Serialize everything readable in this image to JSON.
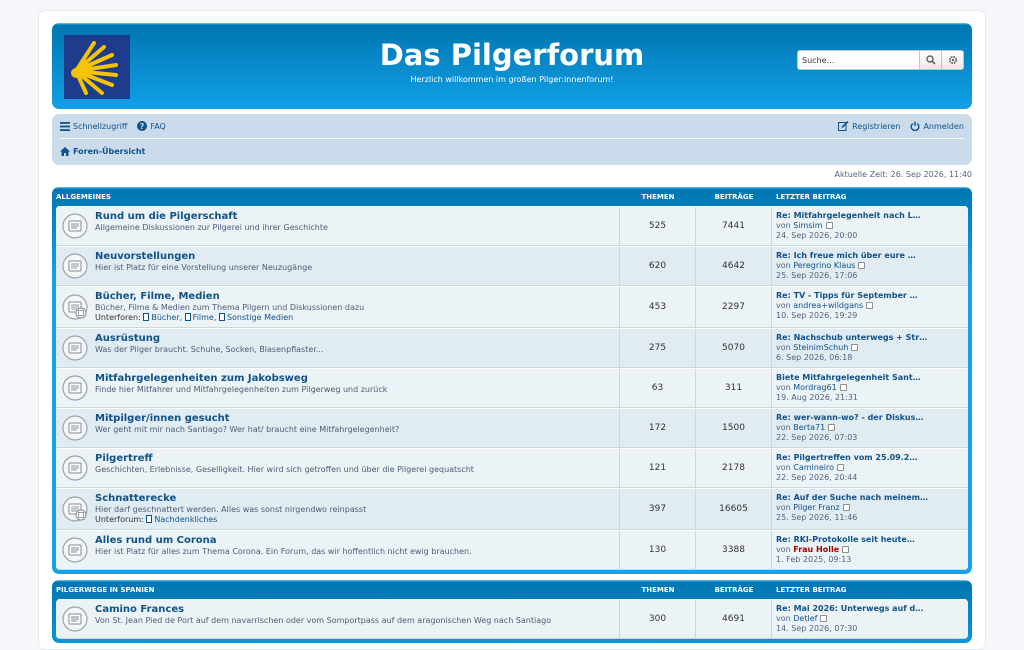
{
  "site": {
    "title": "Das Pilgerforum",
    "description": "Herzlich willkommen im großen Pilger:innenforum!",
    "search_placeholder": "Suche…"
  },
  "nav": {
    "quick_links": "Schnellzugriff",
    "faq": "FAQ",
    "register": "Registrieren",
    "login": "Anmelden",
    "index": "Foren-Übersicht"
  },
  "current_time": "Aktuelle Zeit: 26. Sep 2026, 11:40",
  "headers": {
    "topics": "THEMEN",
    "posts": "BEITRÄGE",
    "last_post": "LETZTER BEITRAG"
  },
  "categories": [
    {
      "name": "ALLGEMEINES",
      "forums": [
        {
          "title": "Rund um die Pilgerschaft",
          "desc": "Allgemeine Diskussionen zur Pilgerei und ihrer Geschichte",
          "topics": "525",
          "posts": "7441",
          "last_title": "Re: Mitfahrgelegenheit nach L…",
          "by": "von",
          "author": "Simsim",
          "date": "24. Sep 2026, 20:00"
        },
        {
          "title": "Neuvorstellungen",
          "desc": "Hier ist Platz für eine Vorstellung unserer Neuzugänge",
          "topics": "620",
          "posts": "4642",
          "last_title": "Re: Ich freue mich über eure …",
          "by": "von",
          "author": "Peregrino Klaus",
          "date": "25. Sep 2026, 17:06"
        },
        {
          "title": "Bücher, Filme, Medien",
          "desc": "Bücher, Filme & Medien zum Thema Pilgern und Diskussionen dazu",
          "sub_label": "Unterforen:",
          "subs": [
            "Bücher,",
            "Filme,",
            "Sonstige Medien"
          ],
          "topics": "453",
          "posts": "2297",
          "last_title": "Re: TV - Tipps für September …",
          "by": "von",
          "author": "andrea+wildgans",
          "date": "10. Sep 2026, 19:29"
        },
        {
          "title": "Ausrüstung",
          "desc": "Was der Pilger braucht. Schuhe, Socken, Blasenpflaster...",
          "topics": "275",
          "posts": "5070",
          "last_title": "Re: Nachschub unterwegs + Str…",
          "by": "von",
          "author": "SteinimSchuh",
          "date": "6. Sep 2026, 06:18"
        },
        {
          "title": "Mitfahrgelegenheiten zum Jakobsweg",
          "desc": "Finde hier Mitfahrer und Mitfahrgelegenheiten zum Pilgerweg und zurück",
          "topics": "63",
          "posts": "311",
          "last_title": "Biete Mitfahrgelegenheit Sant…",
          "by": "von",
          "author": "Mordrag61",
          "date": "19. Aug 2026, 21:31"
        },
        {
          "title": "Mitpilger/innen gesucht",
          "desc": "Wer geht mit mir nach Santiago? Wer hat/ braucht eine Mitfahrgelegenheit?",
          "topics": "172",
          "posts": "1500",
          "last_title": "Re: wer-wann-wo? - der Diskus…",
          "by": "von",
          "author": "Berta71",
          "date": "22. Sep 2026, 07:03"
        },
        {
          "title": "Pilgertreff",
          "desc": "Geschichten, Erlebnisse, Geselligkeit. Hier wird sich getroffen und über die Pilgerei gequatscht",
          "topics": "121",
          "posts": "2178",
          "last_title": "Re: Pilgertreffen vom 25.09.2…",
          "by": "von",
          "author": "Camineiro",
          "date": "22. Sep 2026, 20:44"
        },
        {
          "title": "Schnatterecke",
          "desc": "Hier darf geschnattert werden. Alles was sonst nirgendwo reinpasst",
          "sub_label": "Unterforum:",
          "subs": [
            "Nachdenkliches"
          ],
          "topics": "397",
          "posts": "16605",
          "last_title": "Re: Auf der Suche nach meinem…",
          "by": "von",
          "author": "Pilger Franz",
          "date": "25. Sep 2026, 11:46"
        },
        {
          "title": "Alles rund um Corona",
          "desc": "Hier ist Platz für alles zum Thema Corona. Ein Forum, das wir hoffentlich nicht ewig brauchen.",
          "topics": "130",
          "posts": "3388",
          "last_title": "Re: RKI-Protokolle seit heute…",
          "by": "von",
          "author": "Frau Holle",
          "author_red": true,
          "date": "1. Feb 2025, 09:13"
        }
      ]
    },
    {
      "name": "PILGERWEGE IN SPANIEN",
      "forums": [
        {
          "title": "Camino Frances",
          "desc": "Von St. Jean Pied de Port auf dem navarrischen oder vom Somportpass auf dem aragonischen Weg nach Santiago",
          "topics": "300",
          "posts": "4691",
          "last_title": "Re: Mai 2026: Unterwegs auf d…",
          "by": "von",
          "author": "Detlef",
          "date": "14. Sep 2026, 07:30"
        }
      ]
    }
  ],
  "colors": {
    "header": "#12a3eb",
    "nav": "#cadceb",
    "link": "#105289",
    "red_user": "#aa0000"
  }
}
